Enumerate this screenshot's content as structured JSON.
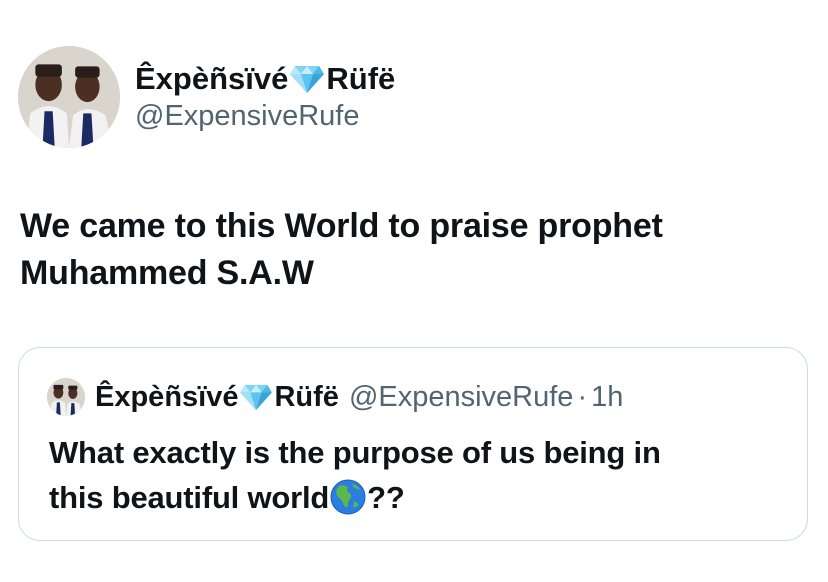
{
  "author": {
    "name_part1": "Êxpèñsïvé",
    "name_part2": "Rüfë",
    "name_emoji": "gem-stone-icon",
    "handle": "@ExpensiveRufe"
  },
  "tweet": {
    "line1": "We came to this World to praise prophet",
    "line2": "Muhammed S.A.W"
  },
  "quoted_tweet": {
    "name_part1": "Êxpèñsïvé",
    "name_part2": "Rüfë",
    "handle": "@ExpensiveRufe",
    "separator": "·",
    "time": "1h",
    "line1": "What exactly is the purpose of us being in",
    "line2_text": "this beautiful world",
    "line2_emoji": "globe-americas-icon",
    "line2_suffix": "??"
  },
  "colors": {
    "text": "#0f1419",
    "secondary": "#536471",
    "border": "#cfd9de",
    "background": "#ffffff"
  }
}
